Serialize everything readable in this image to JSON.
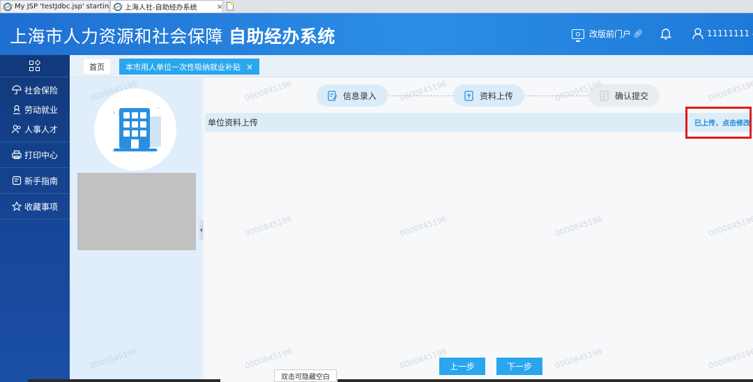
{
  "browser": {
    "tabs": [
      {
        "label": "My JSP 'testJdbc.jsp' startin...",
        "active": false
      },
      {
        "label": "上海人社-自助经办系统",
        "active": true,
        "close": "×"
      }
    ]
  },
  "header": {
    "title": "上海市人力资源和社会保障",
    "title_bold": "自助经办系统",
    "portal_label": "改版前门户",
    "username": "11111111"
  },
  "sidebar": {
    "groups": [
      {
        "items": [
          {
            "label": "社会保险",
            "icon": "umbrella-icon"
          },
          {
            "label": "劳动就业",
            "icon": "worker-icon"
          },
          {
            "label": "人事人才",
            "icon": "people-icon"
          }
        ]
      },
      {
        "items": [
          {
            "label": "打印中心",
            "icon": "printer-icon"
          }
        ]
      },
      {
        "items": [
          {
            "label": "新手指南",
            "icon": "guide-icon"
          }
        ]
      },
      {
        "items": [
          {
            "label": "收藏事项",
            "icon": "star-icon"
          }
        ]
      }
    ]
  },
  "tabbar": {
    "home": "首页",
    "current": "本市用人单位一次性吸纳就业补贴",
    "close": "×"
  },
  "steps": [
    {
      "label": "信息录入",
      "state": "done"
    },
    {
      "label": "资料上传",
      "state": "current"
    },
    {
      "label": "确认提交",
      "state": "pending"
    }
  ],
  "section": {
    "title": "单位资料上传",
    "upload_status": "已上传，点击修改"
  },
  "buttons": {
    "prev": "上一步",
    "next": "下一步"
  },
  "tooltip": "双击可隐藏空白",
  "watermark": "0000845196",
  "colors": {
    "header": "#2b8ee6",
    "sidebar": "#17489a",
    "accent": "#2aa6ee",
    "highlight_frame": "#e01b1b"
  }
}
